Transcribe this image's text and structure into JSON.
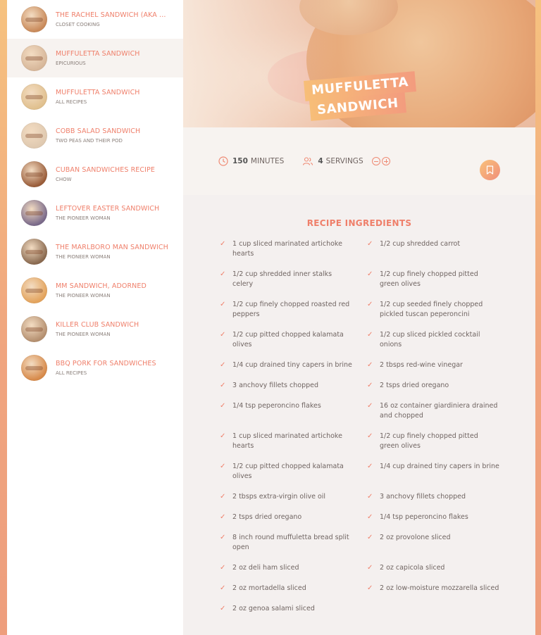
{
  "sidebar": {
    "items": [
      {
        "title": "THE RACHEL SANDWICH (AKA RO...",
        "source": "CLOSET COOKING",
        "thumb_color": "#c98a5a"
      },
      {
        "title": "MUFFULETTA SANDWICH",
        "source": "EPICURIOUS",
        "thumb_color": "#d7b79a",
        "active": true
      },
      {
        "title": "MUFFULETTA SANDWICH",
        "source": "ALL RECIPES",
        "thumb_color": "#e0c08e"
      },
      {
        "title": "COBB SALAD SANDWICH",
        "source": "TWO PEAS AND THEIR POD",
        "thumb_color": "#dfc9b0"
      },
      {
        "title": "CUBAN SANDWICHES RECIPE",
        "source": "CHOW",
        "thumb_color": "#9a5d3a"
      },
      {
        "title": "LEFTOVER EASTER SANDWICH",
        "source": "THE PIONEER WOMAN",
        "thumb_color": "#7a6a8a"
      },
      {
        "title": "THE MARLBORO MAN SANDWICH",
        "source": "THE PIONEER WOMAN",
        "thumb_color": "#8a6a50"
      },
      {
        "title": "MM SANDWICH, ADORNED",
        "source": "THE PIONEER WOMAN",
        "thumb_color": "#e3a35c"
      },
      {
        "title": "KILLER CLUB SANDWICH",
        "source": "THE PIONEER WOMAN",
        "thumb_color": "#b59070"
      },
      {
        "title": "BBQ PORK FOR SANDWICHES",
        "source": "ALL RECIPES",
        "thumb_color": "#d78a4a"
      }
    ]
  },
  "recipe": {
    "title_line1": "MUFFULETTA",
    "title_line2": "SANDWICH",
    "minutes_value": "150",
    "minutes_label": "MINUTES",
    "servings_value": "4",
    "servings_label": "SERVINGS"
  },
  "ingredients": {
    "heading": "RECIPE INGREDIENTS",
    "items": [
      "1 cup sliced marinated artichoke hearts",
      "1/2 cup shredded carrot",
      "1/2 cup shredded inner stalks celery",
      "1/2 cup finely chopped pitted green olives",
      "1/2 cup finely chopped roasted red peppers",
      "1/2 cup seeded finely chopped pickled tuscan peperoncini",
      "1/2 cup pitted chopped kalamata olives",
      "1/2 cup sliced pickled cocktail onions",
      "1/4 cup drained tiny capers in brine",
      "2 tbsps red-wine vinegar",
      "3 anchovy fillets chopped",
      "2 tsps dried oregano",
      "1/4 tsp peperoncino flakes",
      "16 oz container giardiniera drained and chopped",
      "1 cup sliced marinated artichoke hearts",
      "1/2 cup finely chopped pitted green olives",
      "1/2 cup pitted chopped kalamata olives",
      "1/4 cup drained tiny capers in brine",
      "2 tbsps extra-virgin olive oil",
      "3 anchovy fillets chopped",
      "2 tsps dried oregano",
      "1/4 tsp peperoncino flakes",
      "8 inch round muffuletta bread split open",
      "2 oz provolone sliced",
      "2 oz deli ham sliced",
      "2 oz capicola sliced",
      "2 oz mortadella sliced",
      "2 oz low-moisture mozzarella sliced",
      "2 oz genoa salami sliced"
    ]
  },
  "colors": {
    "accent": "#ef7f6a",
    "gradient_start": "#f7be78",
    "gradient_end": "#f39c7e"
  }
}
